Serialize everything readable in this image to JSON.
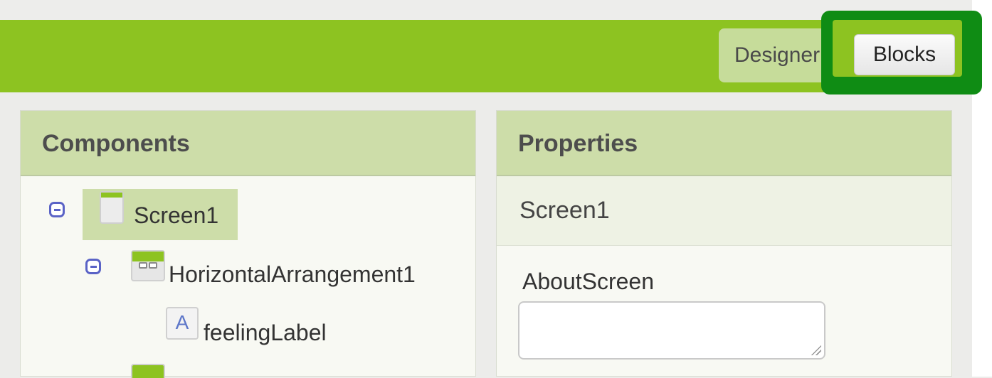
{
  "toolbar": {
    "designer_label": "Designer",
    "blocks_label": "Blocks"
  },
  "components": {
    "title": "Components",
    "items": [
      {
        "label": "Screen1",
        "type": "screen"
      },
      {
        "label": "HorizontalArrangement1",
        "type": "horizontal-arrangement"
      },
      {
        "label": "feelingLabel",
        "type": "label"
      }
    ]
  },
  "properties": {
    "title": "Properties",
    "component_name": "Screen1",
    "fields": [
      {
        "label": "AboutScreen",
        "value": ""
      }
    ]
  },
  "colors": {
    "toolbar": "#8dc321",
    "highlight_border": "#0f8c14",
    "panel_header": "#cddda9",
    "collapse_icon": "#5a63c6"
  },
  "icons": [
    "collapse-icon",
    "screen-icon",
    "horizontal-arrangement-icon",
    "label-icon",
    "resize-grip-icon"
  ]
}
